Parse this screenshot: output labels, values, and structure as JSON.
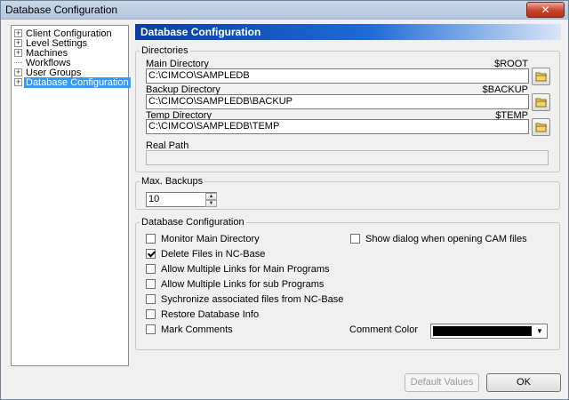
{
  "window": {
    "title": "Database Configuration",
    "close_glyph": "✕"
  },
  "tree": {
    "items": [
      {
        "label": "Client Configuration",
        "expander": "+"
      },
      {
        "label": "Level Settings",
        "expander": "+"
      },
      {
        "label": "Machines",
        "expander": "+"
      },
      {
        "label": "Workflows",
        "expander": ""
      },
      {
        "label": "User Groups",
        "expander": "+"
      },
      {
        "label": "Database Configuration",
        "expander": "+",
        "selected": true
      }
    ]
  },
  "header": {
    "title": "Database Configuration"
  },
  "directories": {
    "legend": "Directories",
    "main": {
      "label": "Main Directory",
      "var": "$ROOT",
      "value": "C:\\CIMCO\\SAMPLEDB"
    },
    "backup": {
      "label": "Backup Directory",
      "var": "$BACKUP",
      "value": "C:\\CIMCO\\SAMPLEDB\\BACKUP"
    },
    "temp": {
      "label": "Temp Directory",
      "var": "$TEMP",
      "value": "C:\\CIMCO\\SAMPLEDB\\TEMP"
    },
    "real_path": {
      "label": "Real Path",
      "value": ""
    },
    "browse_icon": "folder-icon"
  },
  "max_backups": {
    "legend": "Max. Backups",
    "value": "10"
  },
  "db_config": {
    "legend": "Database Configuration",
    "options": [
      {
        "label": "Monitor Main Directory",
        "checked": false
      },
      {
        "label": "Delete Files in NC-Base",
        "checked": true
      },
      {
        "label": "Allow Multiple Links for Main Programs",
        "checked": false
      },
      {
        "label": "Allow Multiple Links for sub Programs",
        "checked": false
      },
      {
        "label": "Sychronize associated files from NC-Base",
        "checked": false
      },
      {
        "label": "Restore Database Info",
        "checked": false
      },
      {
        "label": "Mark Comments",
        "checked": false
      }
    ],
    "show_dialog": {
      "label": "Show dialog when opening CAM files",
      "checked": false
    },
    "comment_color": {
      "label": "Comment Color",
      "value": "#000000"
    }
  },
  "buttons": {
    "default_values": "Default Values",
    "ok": "OK"
  },
  "colors": {
    "header_start": "#0a3fa0",
    "header_end": "#d8e6f6",
    "selection": "#3399ff"
  }
}
